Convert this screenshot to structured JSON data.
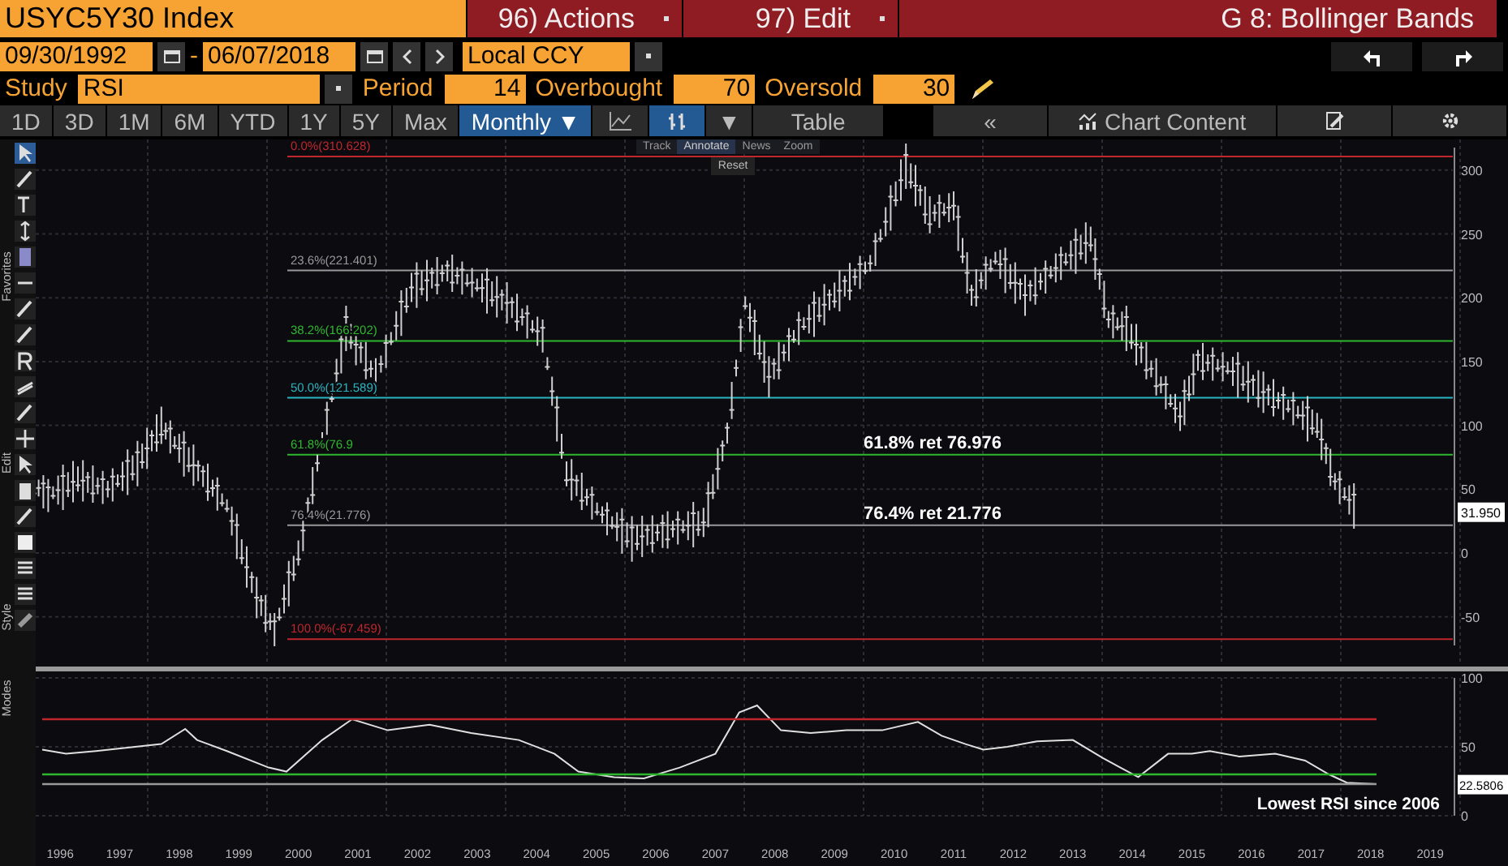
{
  "header": {
    "security": "USYC5Y30 Index",
    "menus": [
      {
        "label": "96) Actions"
      },
      {
        "label": "97) Edit"
      }
    ],
    "title": "G 8: Bollinger Bands"
  },
  "range": {
    "start": "09/30/1992",
    "separator": "-",
    "end": "06/07/2018",
    "currency": "Local CCY"
  },
  "study": {
    "label": "Study",
    "value": "RSI",
    "fields": [
      {
        "label": "Period",
        "value": "14"
      },
      {
        "label": "Overbought",
        "value": "70"
      },
      {
        "label": "Oversold",
        "value": "30"
      }
    ]
  },
  "toolbar": {
    "periods": [
      {
        "label": "1D",
        "selected": false
      },
      {
        "label": "3D",
        "selected": false
      },
      {
        "label": "1M",
        "selected": false
      },
      {
        "label": "6M",
        "selected": false
      },
      {
        "label": "YTD",
        "selected": false
      },
      {
        "label": "1Y",
        "selected": false
      },
      {
        "label": "5Y",
        "selected": false
      },
      {
        "label": "Max",
        "selected": false
      },
      {
        "label": "Monthly ▼",
        "selected": true
      }
    ],
    "dropdown": "▼",
    "table": "Table",
    "collapse": "«",
    "chart_content": "Chart Content"
  },
  "side_toolbar": {
    "sections": [
      "Favorites",
      "Edit",
      "Style",
      "Modes"
    ]
  },
  "chart_tools": [
    {
      "label": "Track",
      "selected": false
    },
    {
      "label": "Annotate",
      "selected": true
    },
    {
      "label": "News",
      "selected": false
    },
    {
      "label": "Zoom",
      "selected": false
    }
  ],
  "reset": "Reset",
  "price_chart": {
    "y_axis_labels": [
      "300",
      "250",
      "200",
      "150",
      "100",
      "50",
      "0",
      "-50"
    ],
    "levels": [
      {
        "label": "0.0%(310.628)",
        "color": "#c0272d"
      },
      {
        "label": "23.6%(221.401)",
        "color": "#9a9a9a"
      },
      {
        "label": "38.2%(166.202)",
        "color": "#2fb82f"
      },
      {
        "label": "50.0%(121.589)",
        "color": "#2bb5c0"
      },
      {
        "label": "61.8%(76.9",
        "color": "#2fb82f"
      },
      {
        "label": "76.4%(21.776)",
        "color": "#9a9a9a"
      },
      {
        "label": "100.0%(-67.459)",
        "color": "#c0272d"
      }
    ],
    "callouts": [
      "61.8% ret 76.976",
      "76.4% ret 21.776"
    ],
    "last_price": "31.950"
  },
  "rsi_chart": {
    "last_value": "22.5806",
    "note": "Lowest RSI since 2006",
    "chart_data": {
      "type": "line",
      "x": [
        1996.2,
        1996.6,
        1997.1,
        1998.2,
        1998.6,
        1998.8,
        1999.3,
        2000.0,
        2000.3,
        2000.9,
        2001.4,
        2002.0,
        2002.7,
        2003.4,
        2004.2,
        2004.8,
        2005.2,
        2005.8,
        2006.3,
        2006.9,
        2007.5,
        2007.9,
        2008.2,
        2008.6,
        2009.1,
        2009.7,
        2010.3,
        2010.9,
        2011.3,
        2011.7,
        2012.0,
        2012.4,
        2012.9,
        2013.5,
        2014.0,
        2014.3,
        2014.6,
        2015.1,
        2015.5,
        2015.8,
        2016.3,
        2016.9,
        2017.4,
        2017.8,
        2018.1,
        2018.6
      ],
      "series": [
        {
          "color": "#e0e0e0",
          "values": [
            48,
            45,
            47,
            52,
            63,
            55,
            47,
            35,
            32,
            55,
            70,
            62,
            66,
            60,
            55,
            45,
            32,
            28,
            27,
            35,
            45,
            75,
            80,
            62,
            60,
            62,
            62,
            68,
            58,
            52,
            48,
            50,
            54,
            55,
            42,
            35,
            28,
            45,
            45,
            47,
            43,
            45,
            40,
            30,
            24,
            23
          ]
        },
        {
          "color": "#c0272d",
          "values": [
            70,
            70,
            70,
            70,
            70,
            70,
            70,
            70,
            70,
            70,
            70,
            70,
            70,
            70,
            70,
            70,
            70,
            70,
            70,
            70,
            70,
            70,
            70,
            70,
            70,
            70,
            70,
            70,
            70,
            70,
            70,
            70,
            70,
            70,
            70,
            70,
            70,
            70,
            70,
            70,
            70,
            70,
            70,
            70,
            70,
            70
          ]
        },
        {
          "color": "#2fb82f",
          "values": [
            30,
            30,
            30,
            30,
            30,
            30,
            30,
            30,
            30,
            30,
            30,
            30,
            30,
            30,
            30,
            30,
            30,
            30,
            30,
            30,
            30,
            30,
            30,
            30,
            30,
            30,
            30,
            30,
            30,
            30,
            30,
            30,
            30,
            30,
            30,
            30,
            30,
            30,
            30,
            30,
            30,
            30,
            30,
            30,
            30,
            30
          ]
        },
        {
          "color": "#9a9a9a",
          "values": [
            23,
            23,
            23,
            23,
            23,
            23,
            23,
            23,
            23,
            23,
            23,
            23,
            23,
            23,
            23,
            23,
            23,
            23,
            23,
            23,
            23,
            23,
            23,
            23,
            23,
            23,
            23,
            23,
            23,
            23,
            23,
            23,
            23,
            23,
            23,
            23,
            23,
            23,
            23,
            23,
            23,
            23,
            23,
            23,
            23,
            23
          ]
        }
      ],
      "xlim": [
        1996.09,
        2019.88
      ],
      "ylim": [
        0,
        100
      ],
      "yticks": [
        0,
        50,
        100
      ],
      "grid": true,
      "xticks": [
        {
          "value": 1996.5,
          "label": "1996"
        },
        {
          "value": 1997.5,
          "label": "1997"
        },
        {
          "value": 1998.5,
          "label": "1998"
        },
        {
          "value": 1999.5,
          "label": "1999"
        },
        {
          "value": 2000.5,
          "label": "2000"
        },
        {
          "value": 2001.5,
          "label": "2001"
        },
        {
          "value": 2002.5,
          "label": "2002"
        },
        {
          "value": 2003.5,
          "label": "2003"
        },
        {
          "value": 2004.5,
          "label": "2004"
        },
        {
          "value": 2005.5,
          "label": "2005"
        },
        {
          "value": 2006.5,
          "label": "2006"
        },
        {
          "value": 2007.5,
          "label": "2007"
        },
        {
          "value": 2008.5,
          "label": "2008"
        },
        {
          "value": 2009.5,
          "label": "2009"
        },
        {
          "value": 2010.5,
          "label": "2010"
        },
        {
          "value": 2011.5,
          "label": "2011"
        },
        {
          "value": 2012.5,
          "label": "2012"
        },
        {
          "value": 2013.5,
          "label": "2013"
        },
        {
          "value": 2014.5,
          "label": "2014"
        },
        {
          "value": 2015.5,
          "label": "2015"
        },
        {
          "value": 2016.5,
          "label": "2016"
        },
        {
          "value": 2017.5,
          "label": "2017"
        },
        {
          "value": 2018.5,
          "label": "2018"
        },
        {
          "value": 2019.5,
          "label": "2019"
        }
      ]
    }
  }
}
